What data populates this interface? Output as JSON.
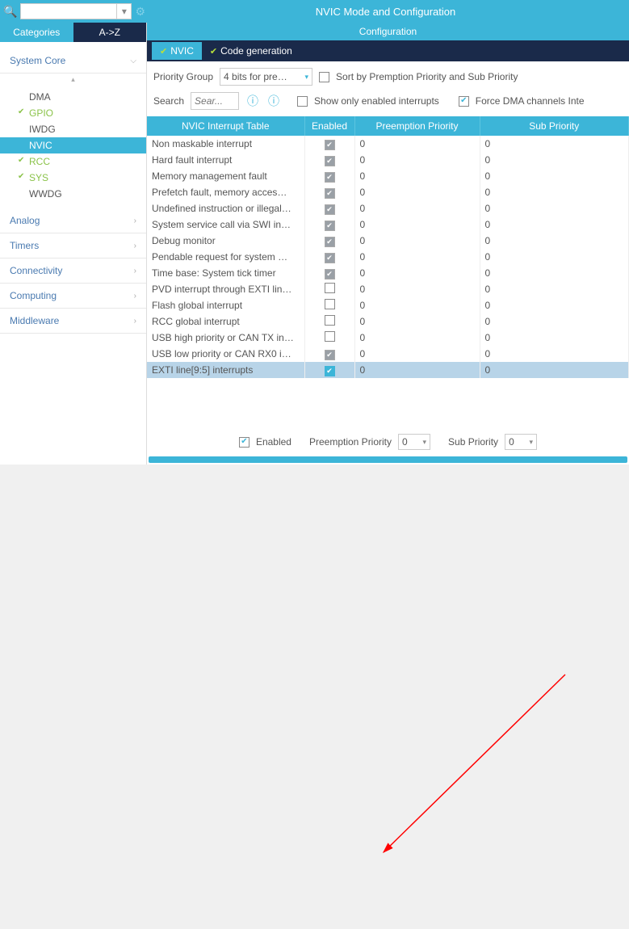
{
  "top": {
    "title": "NVIC Mode and Configuration"
  },
  "sidebar": {
    "tabs": {
      "categories": "Categories",
      "az": "A->Z"
    },
    "groups": [
      {
        "label": "System Core",
        "expanded": true,
        "items": [
          {
            "label": "DMA",
            "state": ""
          },
          {
            "label": "GPIO",
            "state": "green"
          },
          {
            "label": "IWDG",
            "state": ""
          },
          {
            "label": "NVIC",
            "state": "selected"
          },
          {
            "label": "RCC",
            "state": "green"
          },
          {
            "label": "SYS",
            "state": "green"
          },
          {
            "label": "WWDG",
            "state": ""
          }
        ]
      },
      {
        "label": "Analog",
        "expanded": false
      },
      {
        "label": "Timers",
        "expanded": false
      },
      {
        "label": "Connectivity",
        "expanded": false
      },
      {
        "label": "Computing",
        "expanded": false
      },
      {
        "label": "Middleware",
        "expanded": false
      }
    ]
  },
  "config": {
    "header": "Configuration",
    "tabs": {
      "nvic": "NVIC",
      "codegen": "Code generation"
    },
    "priority_group_label": "Priority Group",
    "priority_group_value": "4 bits for pre…",
    "sort_label": "Sort by Premption Priority and Sub Priority",
    "search_label": "Search",
    "search_placeholder": "Sear...",
    "show_only_label": "Show only enabled interrupts",
    "force_dma_label": "Force DMA channels Inte",
    "columns": {
      "c1": "NVIC Interrupt Table",
      "c2": "Enabled",
      "c3": "Preemption Priority",
      "c4": "Sub Priority"
    },
    "rows": [
      {
        "name": "Non maskable interrupt",
        "enabled": "locked",
        "pre": "0",
        "sub": "0"
      },
      {
        "name": "Hard fault interrupt",
        "enabled": "locked",
        "pre": "0",
        "sub": "0"
      },
      {
        "name": "Memory management fault",
        "enabled": "locked",
        "pre": "0",
        "sub": "0"
      },
      {
        "name": "Prefetch fault, memory acces…",
        "enabled": "locked",
        "pre": "0",
        "sub": "0"
      },
      {
        "name": "Undefined instruction or illegal…",
        "enabled": "locked",
        "pre": "0",
        "sub": "0"
      },
      {
        "name": "System service call via SWI in…",
        "enabled": "locked",
        "pre": "0",
        "sub": "0"
      },
      {
        "name": "Debug monitor",
        "enabled": "locked",
        "pre": "0",
        "sub": "0"
      },
      {
        "name": "Pendable request for system …",
        "enabled": "locked",
        "pre": "0",
        "sub": "0"
      },
      {
        "name": "Time base: System tick timer",
        "enabled": "locked",
        "pre": "0",
        "sub": "0"
      },
      {
        "name": "PVD interrupt through EXTI lin…",
        "enabled": "off",
        "pre": "0",
        "sub": "0"
      },
      {
        "name": "Flash global interrupt",
        "enabled": "off",
        "pre": "0",
        "sub": "0"
      },
      {
        "name": "RCC global interrupt",
        "enabled": "off",
        "pre": "0",
        "sub": "0"
      },
      {
        "name": "USB high priority or CAN TX in…",
        "enabled": "off",
        "pre": "0",
        "sub": "0"
      },
      {
        "name": "USB low priority or CAN RX0 i…",
        "enabled": "locked",
        "pre": "0",
        "sub": "0"
      },
      {
        "name": "EXTI line[9:5] interrupts",
        "enabled": "on",
        "pre": "0",
        "sub": "0",
        "selected": true
      }
    ],
    "footer": {
      "enabled_label": "Enabled",
      "pre_label": "Preemption Priority",
      "pre_value": "0",
      "sub_label": "Sub Priority",
      "sub_value": "0"
    }
  }
}
